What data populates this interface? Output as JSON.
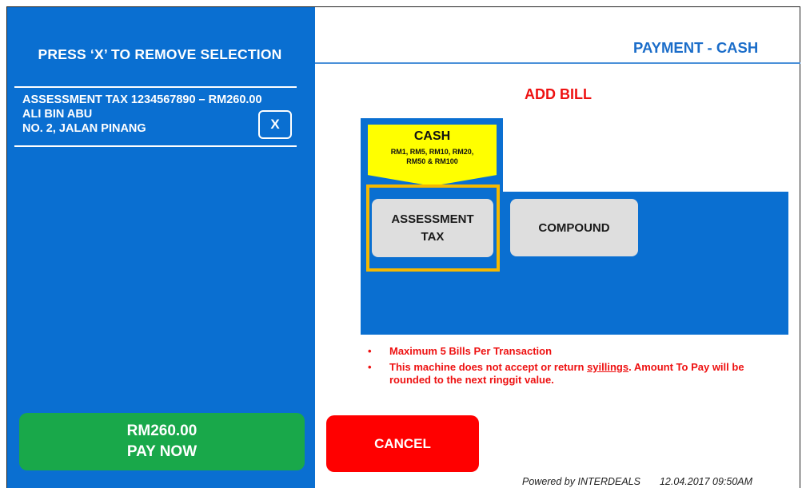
{
  "left": {
    "title": "PRESS ‘X’ TO REMOVE SELECTION",
    "selection": {
      "line1": "ASSESSMENT TAX 1234567890 – RM260.00",
      "line2": "ALI BIN ABU",
      "line3": "NO. 2, JALAN PINANG",
      "remove_label": "X"
    },
    "pay": {
      "amount": "RM260.00",
      "label": "PAY NOW"
    }
  },
  "header": {
    "title": "PAYMENT - CASH"
  },
  "main": {
    "section_title": "ADD BILL",
    "payment_tab": {
      "title": "CASH",
      "line1": "RM1, RM5, RM10, RM20,",
      "line2": "RM50 & RM100"
    },
    "bill_types": [
      {
        "line1": "ASSESSMENT",
        "line2": "TAX",
        "selected": true
      },
      {
        "line1": "COMPOUND",
        "line2": "",
        "selected": false
      }
    ],
    "notes": {
      "note1": "Maximum 5 Bills Per Transaction",
      "note2_pre": "This machine does not accept or return ",
      "note2_underline": "syillings",
      "note2_post": ". Amount To Pay will be rounded to the next ringgit value."
    },
    "cancel_label": "CANCEL"
  },
  "footer": {
    "powered_by": "Powered by INTERDEALS",
    "timestamp": "12.04.2017  09:50AM"
  },
  "colors": {
    "panel_blue": "#0a6fd1",
    "pay_green": "#19a84a",
    "cancel_red": "#ff0000",
    "highlight": "#f5b800",
    "cash_yellow": "#ffff00",
    "alert_red": "#ee1111"
  }
}
